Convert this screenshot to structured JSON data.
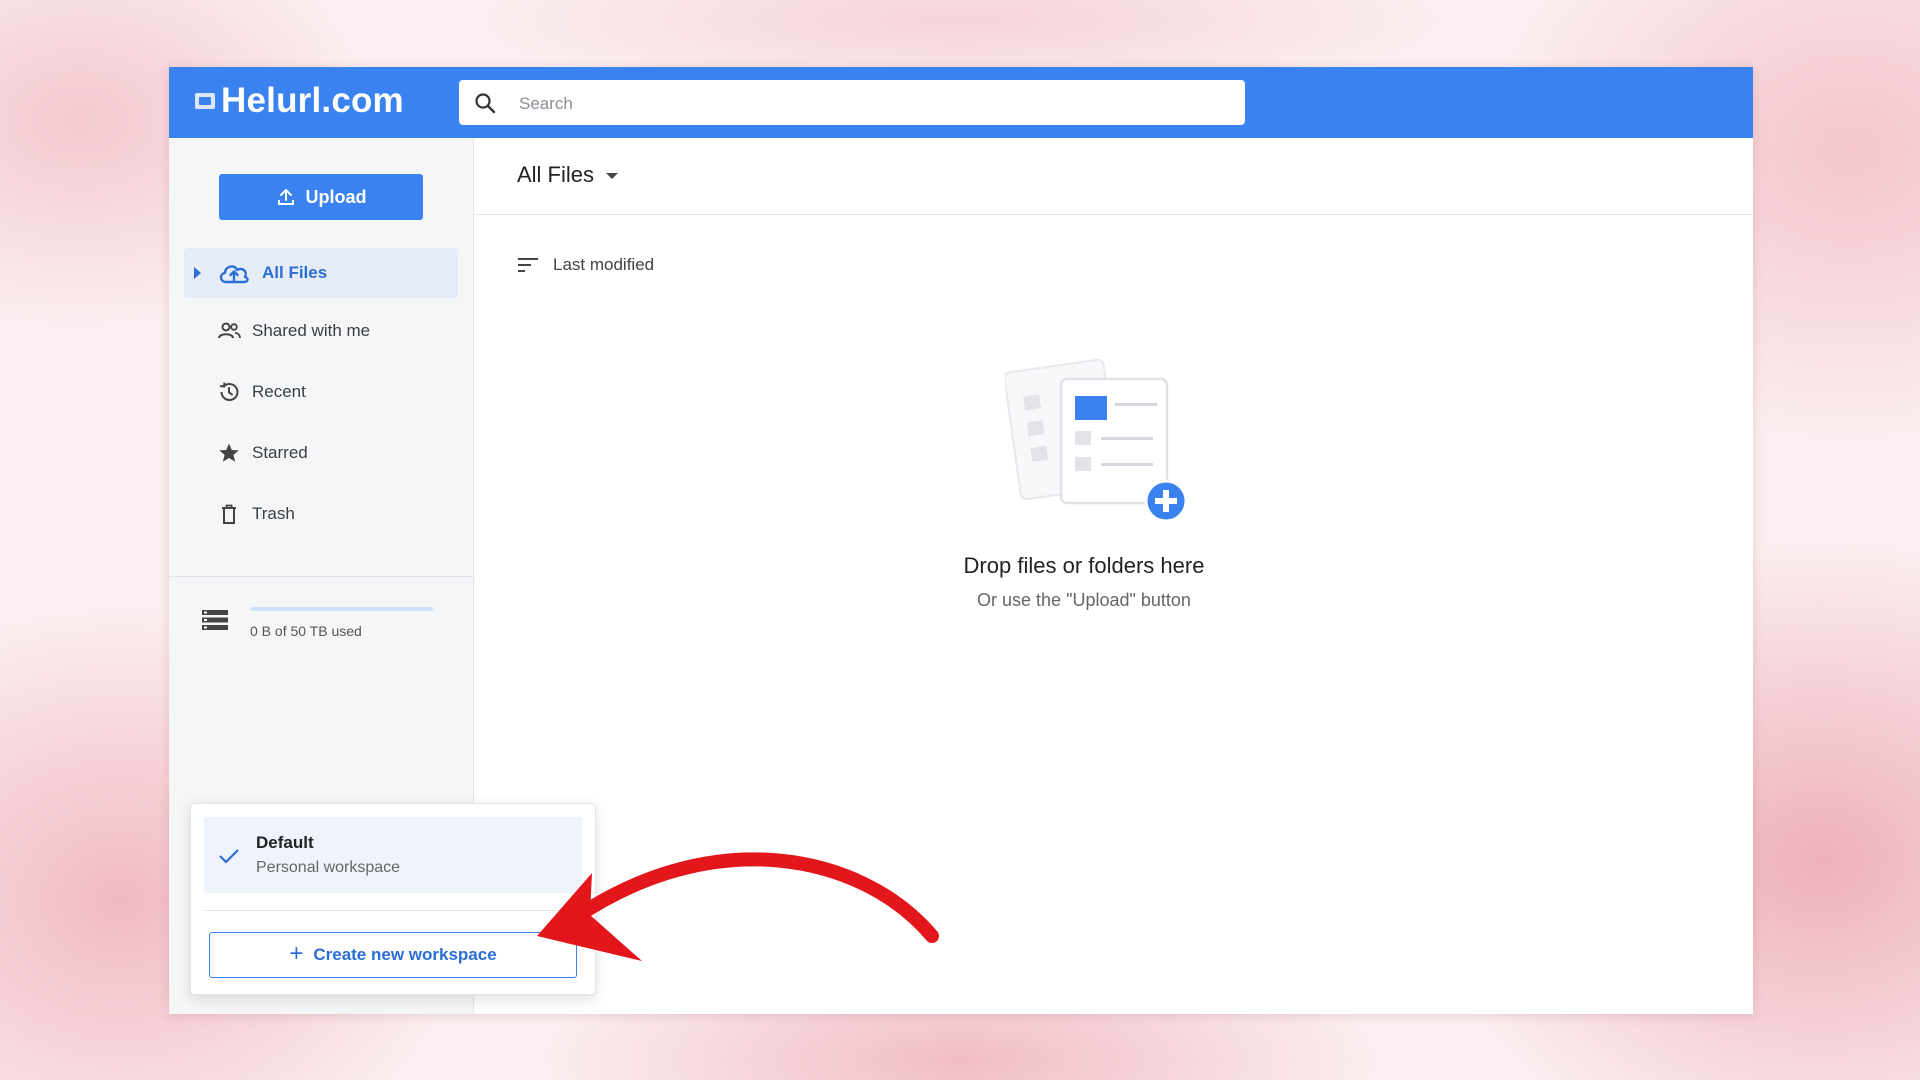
{
  "app": {
    "logo_text": "Helurl.com",
    "brand_color": "#3b82f1"
  },
  "search": {
    "placeholder": "Search"
  },
  "sidebar": {
    "upload_label": "Upload",
    "items": [
      {
        "label": "All Files",
        "icon": "cloud-upload-icon",
        "active": true
      },
      {
        "label": "Shared with me",
        "icon": "people-icon"
      },
      {
        "label": "Recent",
        "icon": "history-icon"
      },
      {
        "label": "Starred",
        "icon": "star-icon"
      },
      {
        "label": "Trash",
        "icon": "trash-icon"
      }
    ],
    "storage": {
      "text": "0 B of 50 TB used",
      "used_fraction": 0.0
    }
  },
  "main": {
    "title": "All Files",
    "sort_label": "Last modified",
    "empty_title": "Drop files or folders here",
    "empty_subtitle": "Or use the \"Upload\" button"
  },
  "workspace_menu": {
    "current": {
      "name": "Default",
      "description": "Personal workspace"
    },
    "create_label": "Create new workspace"
  },
  "annotation": {
    "arrow_color": "#e3161b"
  }
}
